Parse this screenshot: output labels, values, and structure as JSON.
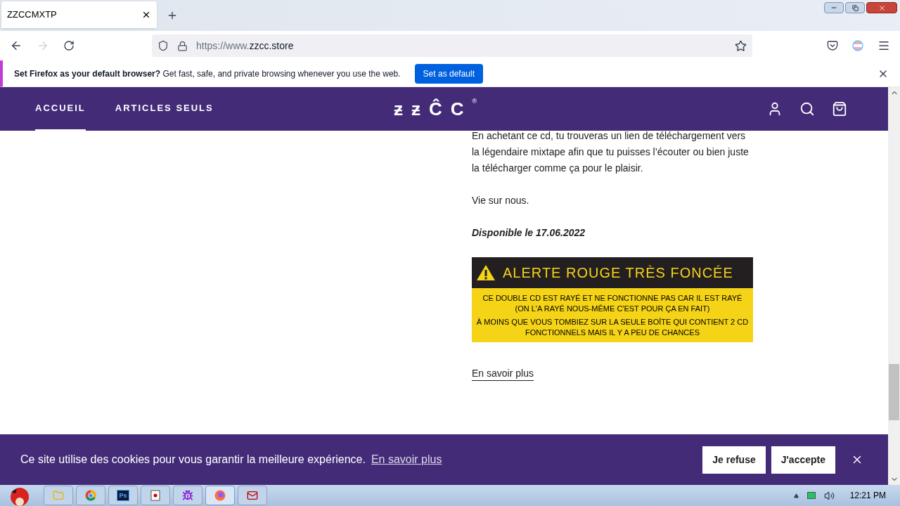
{
  "browser": {
    "tab": {
      "title": "ZZCCMXTP"
    },
    "url": {
      "prefix": "https://www.",
      "domain": "zzcc.store"
    },
    "notification": {
      "bold": "Set Firefox as your default browser?",
      "text": "Get fast, safe, and private browsing whenever you use the web.",
      "button": "Set as default"
    }
  },
  "site": {
    "nav": [
      {
        "label": "ACCUEIL",
        "selected": true
      },
      {
        "label": "ARTICLES SEULS",
        "selected": false
      }
    ],
    "logo": "ƶƶĈC",
    "logo_mark": "®",
    "paragraphs": [
      "En achetant ce cd, tu trouveras un lien de téléchargement vers la légendaire mixtape afin que tu puisses l’écouter ou bien juste la télécharger comme ça pour le plaisir.",
      "Vie sur nous."
    ],
    "availability": "Disponible le 17.06.2022",
    "alert": {
      "title": "ALERTE ROUGE TRÈS FONCÉE",
      "lines": [
        "CE DOUBLE CD EST RAYÉ ET NE FONCTIONNE PAS CAR IL EST RAYÉ (ON L'A RAYÉ NOUS-MÊME C'EST POUR ÇA EN FAIT)",
        "À MOINS QUE VOUS TOMBIEZ SUR LA SEULE BOÎTE QUI CONTIENT 2 CD FONCTIONNELS MAIS IL Y A PEU DE CHANCES"
      ]
    },
    "more_link": "En savoir plus"
  },
  "cookie_bar": {
    "text": "Ce site utilise des cookies pour vous garantir la meilleure expérience.",
    "link": "En savoir plus",
    "buttons": [
      "Je refuse",
      "J'accepte"
    ]
  },
  "taskbar": {
    "apps": [
      {
        "kind": "folder",
        "active": false
      },
      {
        "kind": "chrome",
        "active": false
      },
      {
        "kind": "photoshop",
        "label": "Ps",
        "active": false
      },
      {
        "kind": "cards",
        "active": false
      },
      {
        "kind": "bug",
        "active": false
      },
      {
        "kind": "firefox",
        "active": true
      },
      {
        "kind": "mail",
        "active": false
      }
    ],
    "clock": "12:21 PM"
  }
}
